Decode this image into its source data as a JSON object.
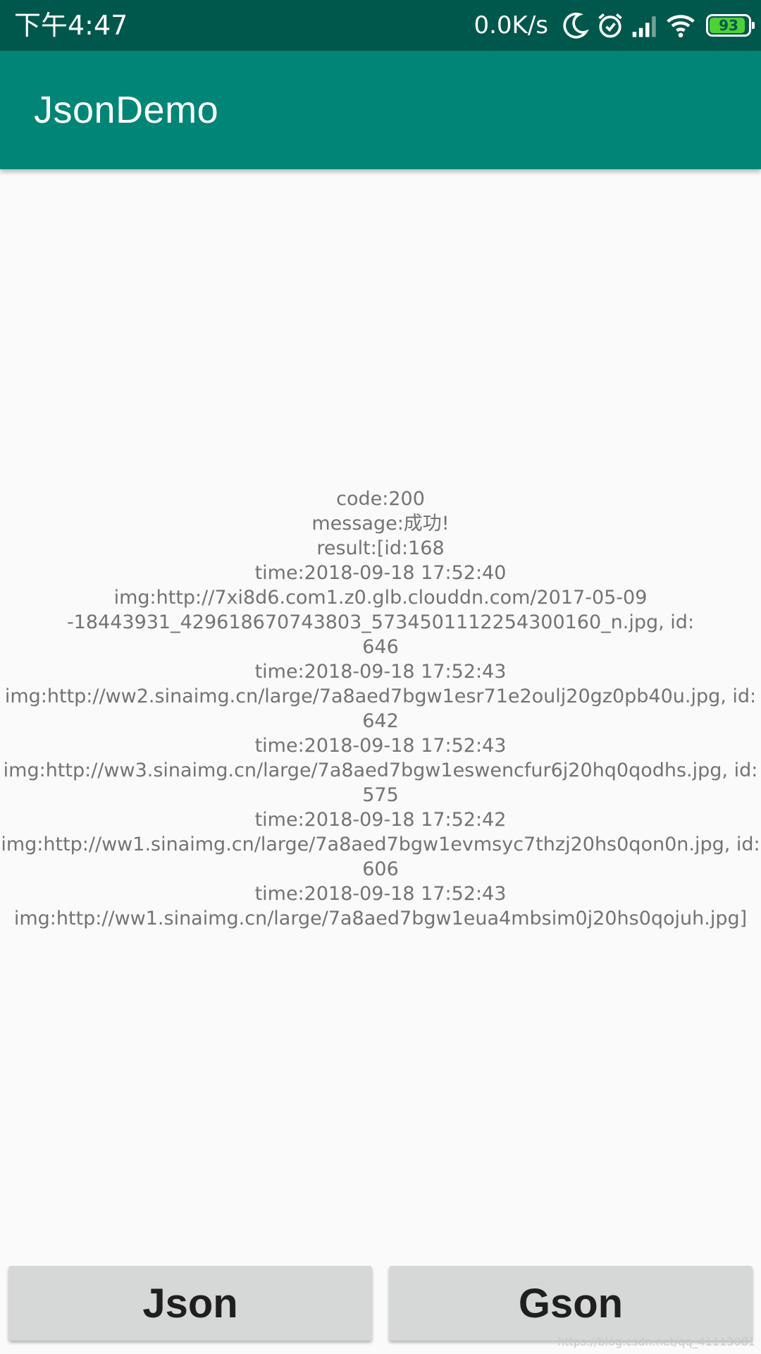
{
  "status_bar": {
    "time": "下午4:47",
    "net_speed": "0.0K/s",
    "battery_level": "93",
    "icons": [
      "moon-icon",
      "alarm-icon",
      "signal-icon",
      "wifi-icon",
      "battery-icon"
    ],
    "colors": {
      "background": "#00574b",
      "battery_fill": "#4cd137"
    }
  },
  "app_bar": {
    "title": "JsonDemo",
    "color": "#008577"
  },
  "result": {
    "lines": [
      "code:200",
      "message:成功!",
      "result:[id:168",
      "time:2018-09-18 17:52:40",
      "img:http://7xi8d6.com1.z0.glb.clouddn.com/2017-05-09",
      "-18443931_429618670743803_5734501112254300160_n.jpg, id:",
      "646",
      "time:2018-09-18 17:52:43",
      "img:http://ww2.sinaimg.cn/large/7a8aed7bgw1esr71e2oulj20gz0pb40u.jpg, id:",
      "642",
      "time:2018-09-18 17:52:43",
      "img:http://ww3.sinaimg.cn/large/7a8aed7bgw1eswencfur6j20hq0qodhs.jpg, id:",
      "575",
      "time:2018-09-18 17:52:42",
      "img:http://ww1.sinaimg.cn/large/7a8aed7bgw1evmsyc7thzj20hs0qon0n.jpg, id:",
      "606",
      "time:2018-09-18 17:52:43",
      "img:http://ww1.sinaimg.cn/large/7a8aed7bgw1eua4mbsim0j20hs0qojuh.jpg]"
    ]
  },
  "buttons": {
    "json_label": "Json",
    "gson_label": "Gson"
  },
  "watermark": "https://blog.csdn.net/qq_41113081"
}
